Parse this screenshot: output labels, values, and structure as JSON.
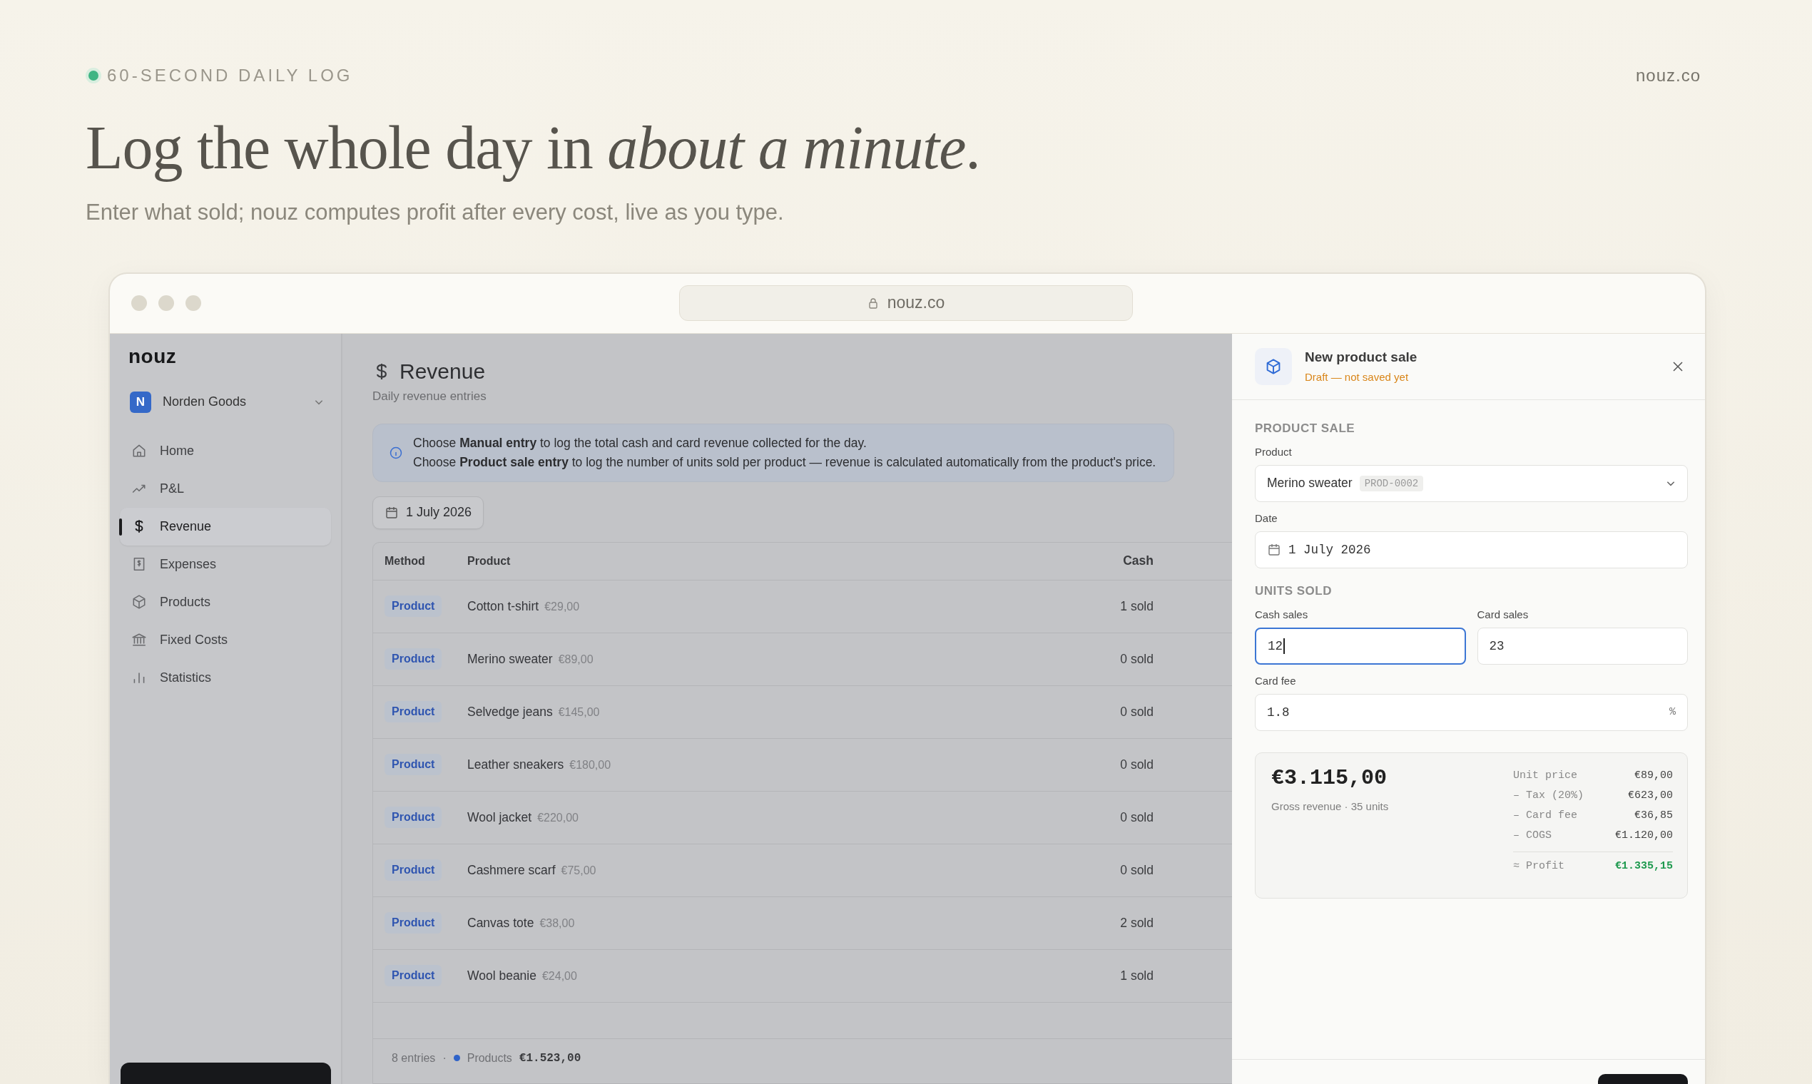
{
  "eyebrow": "60-SECOND DAILY LOG",
  "site": "nouz.co",
  "headline": "Log the whole day in *about a minute*.",
  "subtitle": "Enter what sold; nouz computes profit after every cost, live as you type.",
  "browser": {
    "url": "nouz.co"
  },
  "sidebar": {
    "logo": "nouz",
    "workspace": {
      "initial": "N",
      "name": "Norden Goods"
    },
    "items": [
      {
        "label": "Home",
        "kind": "home",
        "selected": false
      },
      {
        "label": "P&L",
        "kind": "trend",
        "selected": false
      },
      {
        "label": "Revenue",
        "kind": "dollar",
        "selected": true
      },
      {
        "label": "Expenses",
        "kind": "receipt",
        "selected": false
      },
      {
        "label": "Products",
        "kind": "box",
        "selected": false
      },
      {
        "label": "Fixed Costs",
        "kind": "bank",
        "selected": false
      },
      {
        "label": "Statistics",
        "kind": "bars",
        "selected": false
      }
    ]
  },
  "page": {
    "title": "Revenue",
    "subtitle": "Daily revenue entries",
    "info": [
      "Choose **Manual entry** to log the total cash and card revenue collected for the day.",
      "Choose **Product sale entry** to log the number of units sold per product — revenue is calculated automatically from the product's price."
    ],
    "date": "1 July 2026"
  },
  "table": {
    "columns": [
      "Method",
      "Product",
      "Cash"
    ],
    "rows": [
      {
        "method": "Product",
        "product": "Cotton t-shirt",
        "price": "€29,00",
        "cash": "1 sold"
      },
      {
        "method": "Product",
        "product": "Merino sweater",
        "price": "€89,00",
        "cash": "0 sold"
      },
      {
        "method": "Product",
        "product": "Selvedge jeans",
        "price": "€145,00",
        "cash": "0 sold"
      },
      {
        "method": "Product",
        "product": "Leather sneakers",
        "price": "€180,00",
        "cash": "0 sold"
      },
      {
        "method": "Product",
        "product": "Wool jacket",
        "price": "€220,00",
        "cash": "0 sold"
      },
      {
        "method": "Product",
        "product": "Cashmere scarf",
        "price": "€75,00",
        "cash": "0 sold"
      },
      {
        "method": "Product",
        "product": "Canvas tote",
        "price": "€38,00",
        "cash": "2 sold"
      },
      {
        "method": "Product",
        "product": "Wool beanie",
        "price": "€24,00",
        "cash": "1 sold"
      }
    ],
    "footer": {
      "count": "8 entries",
      "separator": "·",
      "legend": "Products",
      "total": "€1.523,00"
    }
  },
  "panel": {
    "title": "New product sale",
    "status": "Draft — not saved yet",
    "sections": [
      {
        "heading": "PRODUCT SALE",
        "fields": [
          {
            "kind": "select",
            "label": "Product",
            "value": "Merino sweater",
            "code": "PROD-0002"
          },
          {
            "kind": "date",
            "label": "Date",
            "value": "1 July 2026"
          }
        ]
      },
      {
        "heading": "UNITS SOLD",
        "fields": [
          {
            "kind": "number",
            "label": "Cash sales",
            "value": "12",
            "focused": true,
            "half": true
          },
          {
            "kind": "number",
            "label": "Card sales",
            "value": "23",
            "focused": false,
            "half": true
          },
          {
            "kind": "number",
            "label": "Card fee",
            "value": "1.8",
            "suffix": "%",
            "focused": false,
            "half": false
          }
        ]
      }
    ],
    "summary": {
      "total": "€3.115,00",
      "caption": "Gross revenue · 35 units",
      "lines": [
        {
          "label": "Unit price",
          "value": "€89,00",
          "kind": "line"
        },
        {
          "label": "– Tax (20%)",
          "value": "€623,00",
          "kind": "line"
        },
        {
          "label": "– Card fee",
          "value": "€36,85",
          "kind": "line"
        },
        {
          "label": "– COGS",
          "value": "€1.120,00",
          "kind": "line"
        },
        {
          "label": "≈ Profit",
          "value": "€1.335,15",
          "kind": "total"
        }
      ]
    }
  }
}
